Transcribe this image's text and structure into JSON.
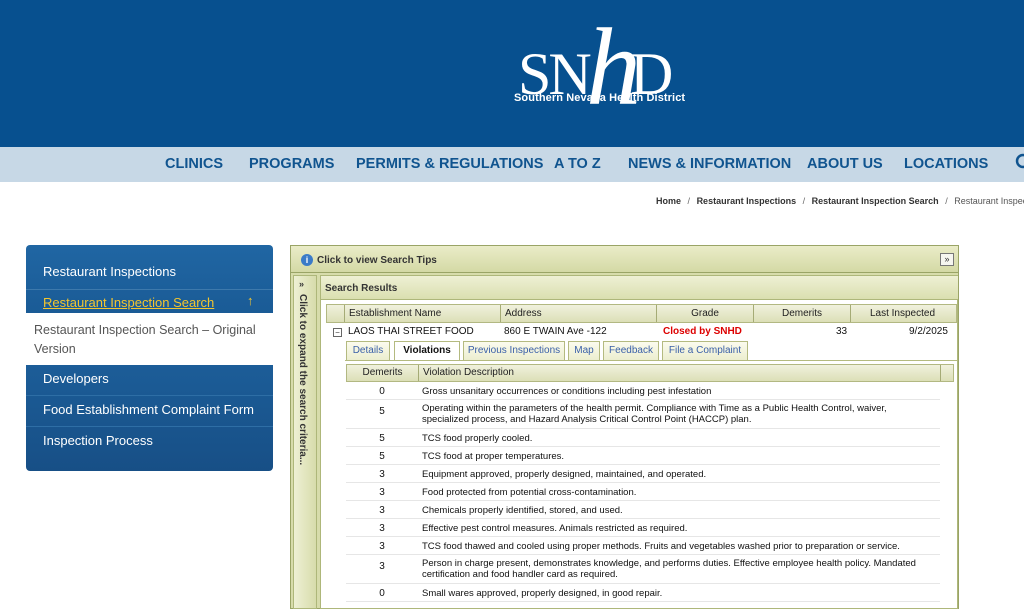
{
  "logo": {
    "letters_left": "SN",
    "letter_h": "h",
    "letters_right": "D",
    "subtitle": "Southern Nevada Health District"
  },
  "nav": {
    "items": [
      "CLINICS",
      "PROGRAMS",
      "PERMITS & REGULATIONS",
      "A TO Z",
      "NEWS & INFORMATION",
      "ABOUT US",
      "LOCATIONS"
    ],
    "search_icon": "search-icon"
  },
  "breadcrumb": {
    "items": [
      "Home",
      "Restaurant Inspections",
      "Restaurant Inspection Search"
    ],
    "current": "Restaurant Inspection S",
    "separator": "/"
  },
  "sidebar": {
    "section_title": "Restaurant Inspections",
    "active_item": "Restaurant Inspection Search",
    "active_icon": "↑",
    "sub_item": "Restaurant Inspection Search – Original Version",
    "links": [
      "Developers",
      "Food Establishment Complaint Form",
      "Inspection Process"
    ]
  },
  "panel": {
    "tips_label": "Click to view Search Tips",
    "tips_toggle": "»",
    "side_chevron": "»",
    "side_label": "Click to expand the search criteria...",
    "results_title": "Search Results",
    "columns": [
      "Establishment Name",
      "Address",
      "Grade",
      "Demerits",
      "Last Inspected"
    ],
    "row": {
      "name": "LAOS THAI STREET FOOD",
      "address": "860 E TWAIN Ave -122",
      "grade": "Closed by SNHD",
      "demerits": "33",
      "last_inspected": "9/2/2025",
      "collapse": "−"
    },
    "tabs": [
      "Details",
      "Violations",
      "Previous Inspections",
      "Map",
      "Feedback",
      "File a Complaint"
    ],
    "active_tab": "Violations",
    "violation_columns": [
      "Demerits",
      "Violation Description"
    ],
    "violations": [
      {
        "demerits": "0",
        "description": "Gross unsanitary occurrences or conditions including pest infestation"
      },
      {
        "demerits": "5",
        "description": "Operating within the parameters of the health permit. Compliance with Time as a Public Health Control, waiver, specialized process, and Hazard Analysis Critical Control Point (HACCP) plan."
      },
      {
        "demerits": "5",
        "description": "TCS food properly cooled."
      },
      {
        "demerits": "5",
        "description": "TCS food at proper temperatures."
      },
      {
        "demerits": "3",
        "description": "Equipment approved, properly designed, maintained, and operated."
      },
      {
        "demerits": "3",
        "description": "Food protected from potential cross-contamination."
      },
      {
        "demerits": "3",
        "description": "Chemicals properly identified, stored, and used."
      },
      {
        "demerits": "3",
        "description": "Effective pest control measures. Animals restricted as required."
      },
      {
        "demerits": "3",
        "description": "TCS food thawed and cooled using proper methods. Fruits and vegetables washed prior to preparation or service."
      },
      {
        "demerits": "3",
        "description": "Person in charge present, demonstrates knowledge, and performs duties. Effective employee health policy. Mandated certification and food handler card as required."
      },
      {
        "demerits": "0",
        "description": "Small wares approved, properly designed, in good repair."
      }
    ]
  }
}
